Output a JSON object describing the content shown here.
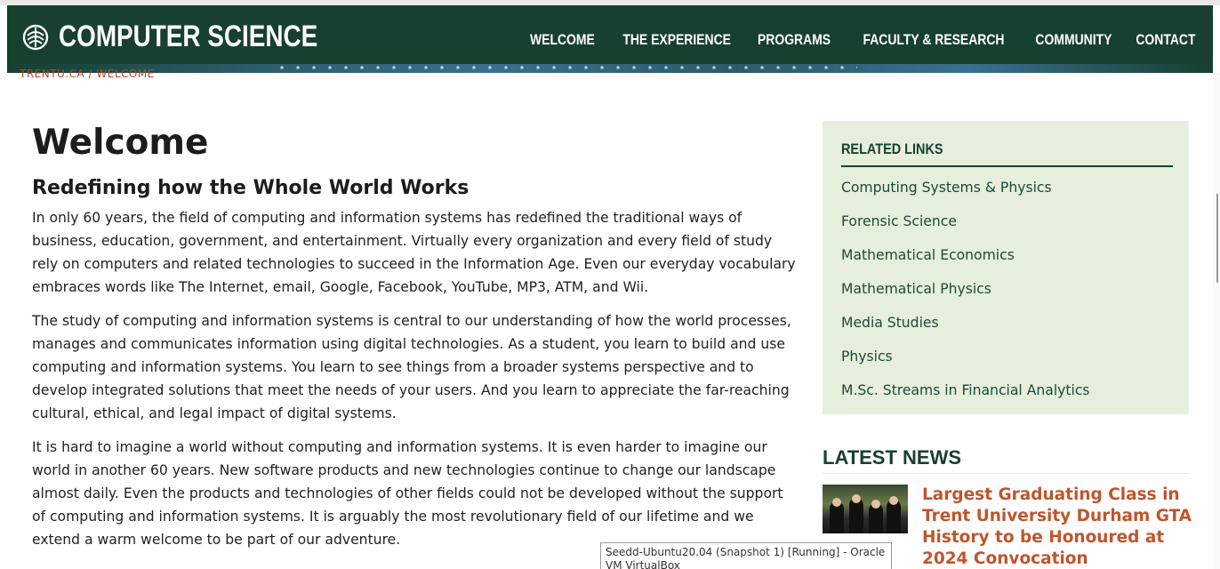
{
  "header": {
    "brand_title": "COMPUTER SCIENCE",
    "brand_icon": "trent-crest-icon",
    "nav": [
      {
        "label": "WELCOME"
      },
      {
        "label": "THE EXPERIENCE"
      },
      {
        "label": "PROGRAMS"
      },
      {
        "label": "FACULTY & RESEARCH"
      },
      {
        "label": "COMMUNITY"
      },
      {
        "label": "CONTACT"
      }
    ]
  },
  "breadcrumb": "TRENTU.CA / WELCOME",
  "main": {
    "title": "Welcome",
    "subtitle": "Redefining how the Whole World Works",
    "paragraphs": [
      "In only 60 years, the field of computing and information systems has redefined the traditional ways of business, education, government, and entertainment.  Virtually every organization and every field of study rely on computers and related technologies to succeed in the Information Age.  Even our everyday vocabulary embraces words like The Internet, email, Google, Facebook, YouTube, MP3, ATM, and Wii.",
      "The study of computing and information systems is central to our understanding of how the world processes, manages and communicates information using digital technologies.  As a student, you learn to build and use computing and information systems.  You learn to see things from a broader systems perspective and to develop integrated solutions that meet the needs of your users.  And you learn to appreciate the far-reaching cultural, ethical, and legal impact of digital systems.",
      "It is hard to imagine a world without computing and information systems.  It is even harder to imagine our world in another 60 years.  New software products and new technologies continue to change our landscape almost daily.  Even the products and technologies of other fields could not be developed without the support of computing and information systems.  It is arguably the most revolutionary field of our lifetime and we extend a warm welcome to be part of our adventure."
    ]
  },
  "related_links": {
    "heading": "RELATED LINKS",
    "items": [
      {
        "label": "Computing Systems & Physics"
      },
      {
        "label": "Forensic Science"
      },
      {
        "label": "Mathematical Economics"
      },
      {
        "label": "Mathematical Physics"
      },
      {
        "label": "Media Studies"
      },
      {
        "label": "Physics"
      },
      {
        "label": "M.Sc. Streams in Financial Analytics"
      }
    ]
  },
  "latest_news": {
    "heading": "LATEST NEWS",
    "items": [
      {
        "title": "Largest Graduating Class in Trent University Durham GTA History to be Honoured at 2024 Convocation"
      }
    ]
  },
  "tooltip": "Seedd-Ubuntu20.04 (Snapshot 1) [Running] - Oracle VM VirtualBox",
  "colors": {
    "header_bg": "#17402f",
    "sidebar_bg": "#e6efdc",
    "accent_link": "#1b4a3a",
    "news_title": "#c0552c"
  }
}
